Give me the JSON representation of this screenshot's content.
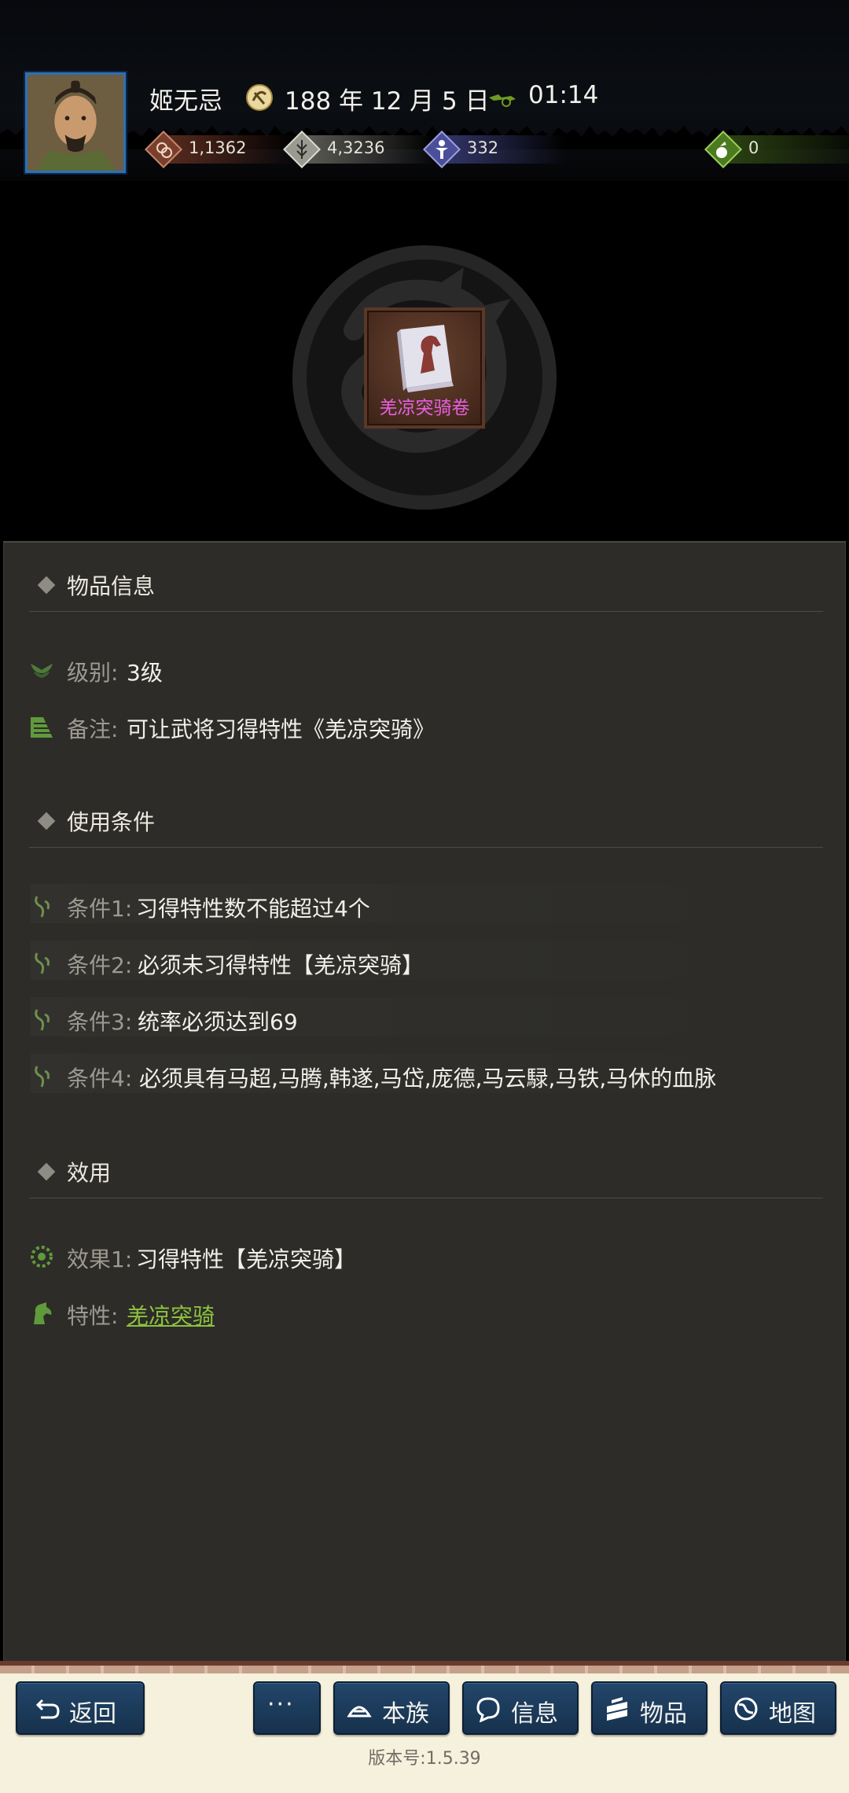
{
  "header": {
    "player_name": "姬无忌",
    "date": "188 年 12 月 5 日",
    "time": "01:14",
    "resources": [
      {
        "icon": "coin-icon",
        "value": "1,1362",
        "color": "#7a3f2c"
      },
      {
        "icon": "grain-icon",
        "value": "4,3236",
        "color": "#9a9a90"
      },
      {
        "icon": "soldier-icon",
        "value": "332",
        "color": "#4b4f9a"
      },
      {
        "icon": "pouch-icon",
        "value": "0",
        "color": "#4b7a1f"
      }
    ]
  },
  "item": {
    "name": "羌凉突骑卷",
    "name_color": "#e85fe2"
  },
  "info_section": {
    "title": "物品信息",
    "level_label": "级别:",
    "level_value": "3级",
    "note_label": "备注:",
    "note_value": "可让武将习得特性《羌凉突骑》"
  },
  "conditions_section": {
    "title": "使用条件",
    "items": [
      {
        "label": "条件1:",
        "value": "习得特性数不能超过4个"
      },
      {
        "label": "条件2:",
        "value": "必须未习得特性【羌凉突骑】"
      },
      {
        "label": "条件3:",
        "value": "统率必须达到69"
      },
      {
        "label": "条件4:",
        "value": "必须具有马超,马腾,韩遂,马岱,庞德,马云騄,马铁,马休的血脉"
      }
    ]
  },
  "effect_section": {
    "title": "效用",
    "effect_label": "效果1:",
    "effect_value": "习得特性【羌凉突骑】",
    "trait_label": "特性:",
    "trait_value": "羌凉突骑",
    "trait_color": "#8cc23e"
  },
  "bottom_bar": {
    "back": "返回",
    "more": "···",
    "clan": "本族",
    "info": "信息",
    "items": "物品",
    "map": "地图",
    "version": "版本号:1.5.39"
  }
}
